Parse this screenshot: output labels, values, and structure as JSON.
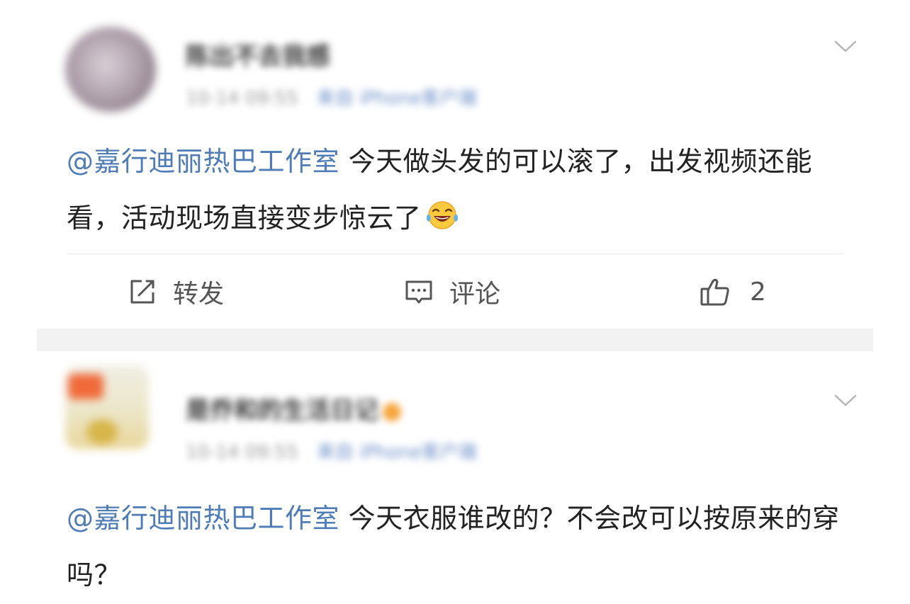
{
  "posts": [
    {
      "username": "陈出不去我感",
      "meta": {
        "time": "10-14 09:55",
        "source": "来自 iPhone客户端"
      },
      "mention": "@嘉行迪丽热巴工作室",
      "text": " 今天做头发的可以滚了，出发视频还能看，活动现场直接变步惊云了",
      "emoji_name": "laughing-tears-emoji",
      "actions": {
        "repost_label": "转发",
        "comment_label": "评论",
        "like_count": "2"
      }
    },
    {
      "username": "是乔和的生活日记",
      "meta": {
        "time": "10-14 09:55",
        "source": "来自 iPhone客户端"
      },
      "mention": "@嘉行迪丽热巴工作室",
      "text": " 今天衣服谁改的？不会改可以按原来的穿吗？"
    }
  ],
  "colors": {
    "mention": "#4f7bb6",
    "text": "#222222",
    "muted": "#555555",
    "separator": "#f2f2f2"
  }
}
